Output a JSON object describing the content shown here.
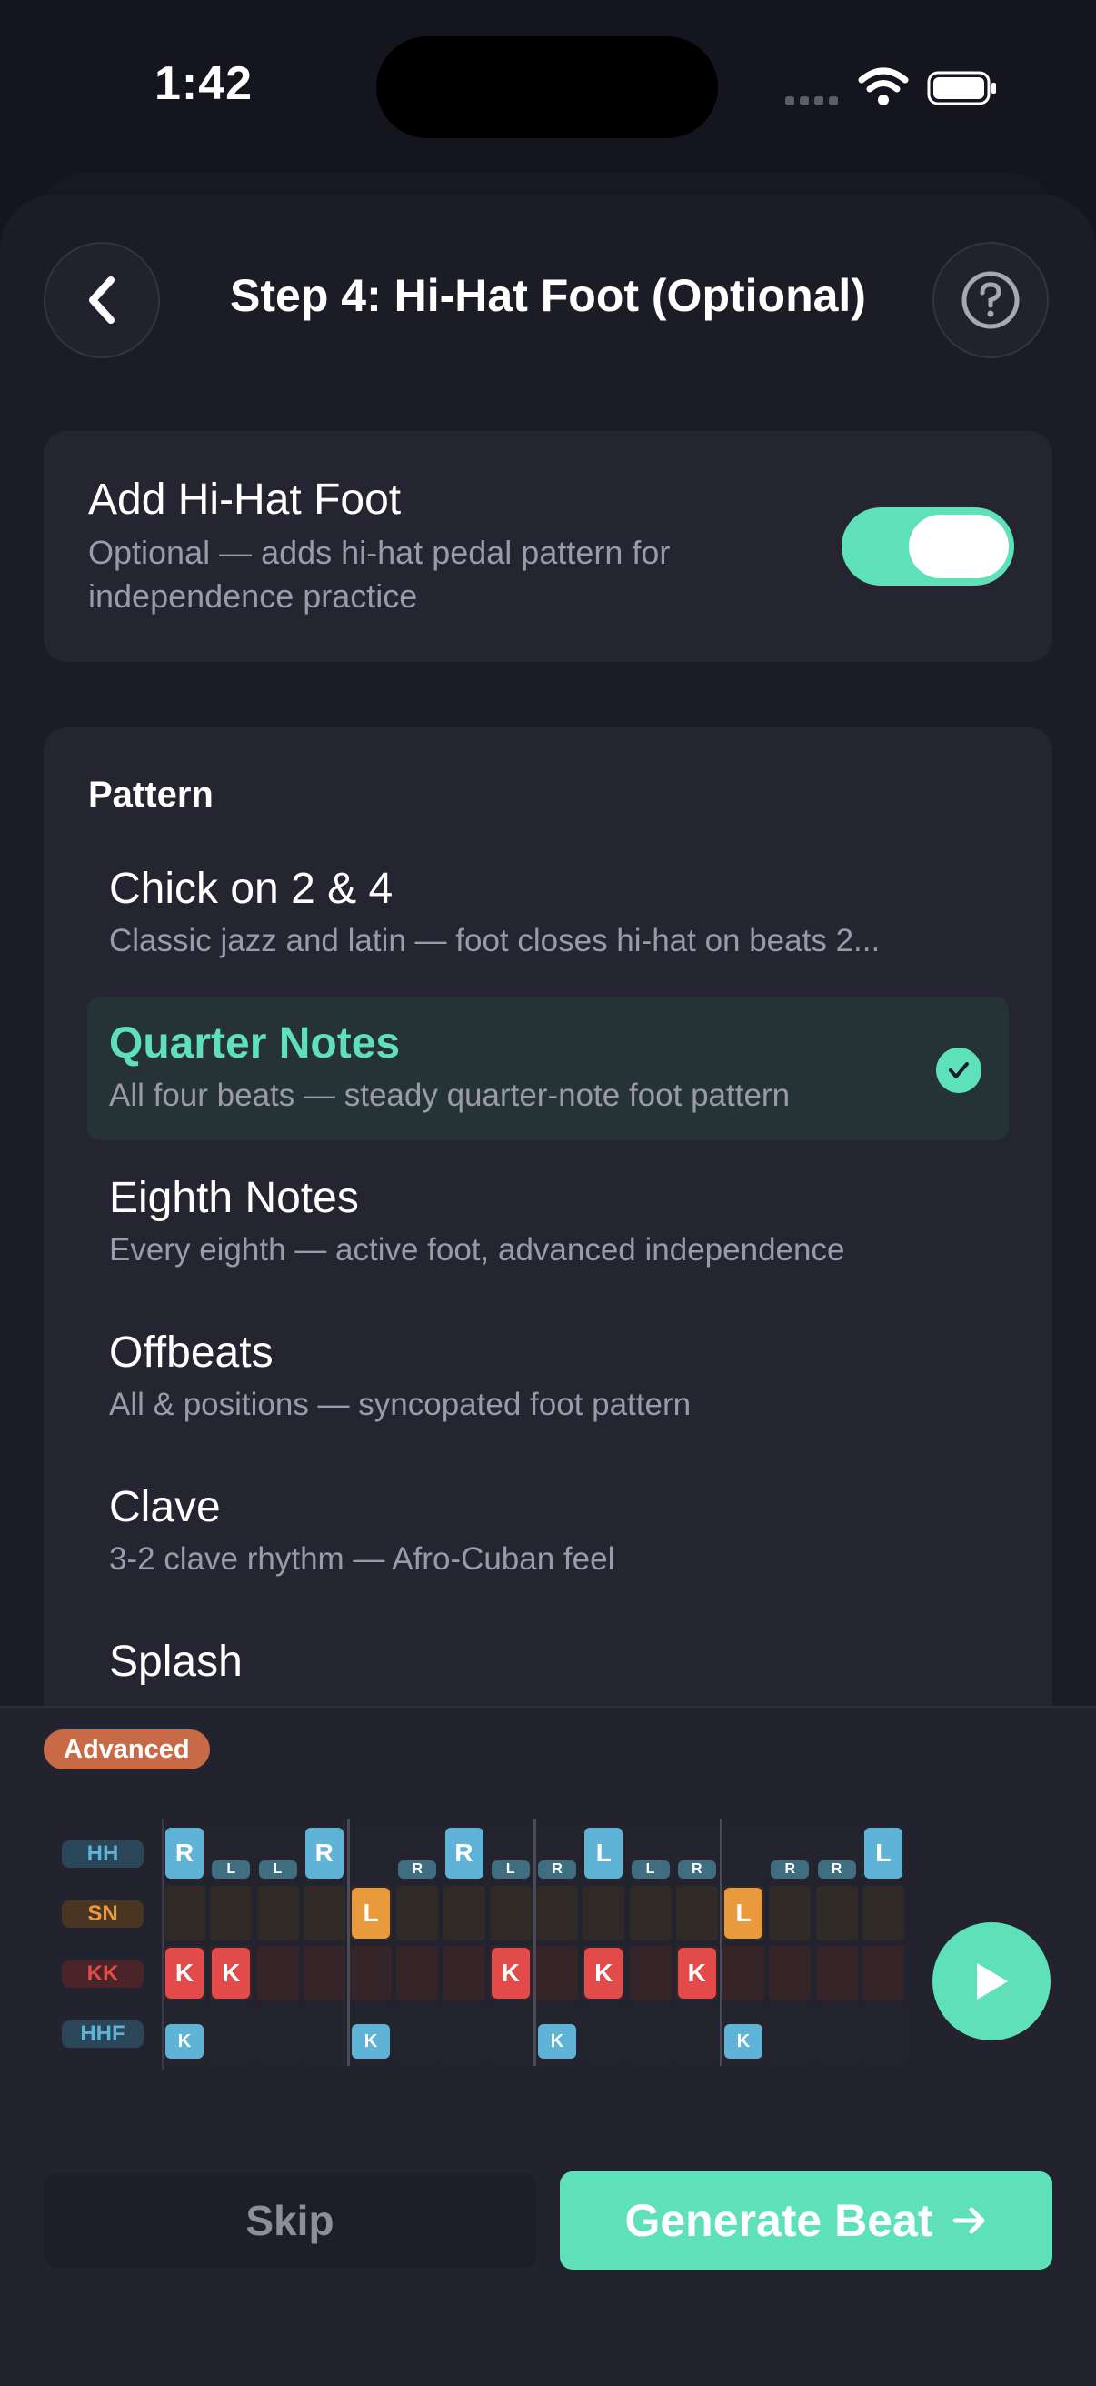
{
  "status_bar": {
    "time": "1:42"
  },
  "header": {
    "title": "Step 4: Hi-Hat Foot (Optional)",
    "back_icon": "chevron-left-icon",
    "help_icon": "question-circle-icon"
  },
  "toggle_card": {
    "title": "Add Hi-Hat Foot",
    "subtitle": "Optional — adds hi-hat pedal pattern for independence practice",
    "enabled": true
  },
  "pattern": {
    "heading": "Pattern",
    "selected": "Quarter Notes",
    "options": [
      {
        "title": "Chick on 2 & 4",
        "subtitle": "Classic jazz and latin — foot closes hi-hat on beats 2..."
      },
      {
        "title": "Quarter Notes",
        "subtitle": "All four beats — steady quarter-note foot pattern"
      },
      {
        "title": "Eighth Notes",
        "subtitle": "Every eighth — active foot, advanced independence"
      },
      {
        "title": "Offbeats",
        "subtitle": "All & positions — syncopated foot pattern"
      },
      {
        "title": "Clave",
        "subtitle": "3-2 clave rhythm — Afro-Cuban feel"
      },
      {
        "title": "Splash",
        "subtitle": ""
      }
    ]
  },
  "preview": {
    "badge": "Advanced",
    "rows": [
      {
        "label": "HH",
        "color": "#5fb3d6",
        "cells": [
          "R",
          "l",
          "l",
          "R",
          "",
          "r",
          "R",
          "l",
          "r",
          "L",
          "l",
          "r",
          "",
          "r",
          "r",
          "L"
        ]
      },
      {
        "label": "SN",
        "color": "#e89a3c",
        "cells": [
          "",
          "",
          "",
          "",
          "L",
          "",
          "",
          "",
          "",
          "",
          "",
          "",
          "L",
          "",
          "",
          ""
        ]
      },
      {
        "label": "KK",
        "color": "#e34b4b",
        "cells": [
          "K",
          "K",
          "",
          "",
          "",
          "",
          "",
          "K",
          "",
          "K",
          "",
          "K",
          "",
          "",
          "",
          ""
        ]
      },
      {
        "label": "HHF",
        "color": "#5fb3d6",
        "cells": [
          "K",
          "",
          "",
          "",
          "K",
          "",
          "",
          "",
          "K",
          "",
          "",
          "",
          "K",
          "",
          "",
          ""
        ]
      }
    ],
    "play_icon": "play-icon"
  },
  "footer": {
    "skip_label": "Skip",
    "generate_label": "Generate Beat",
    "generate_icon": "arrow-right-icon"
  },
  "colors": {
    "accent": "#5ee0b8",
    "badge": "#c96a47"
  }
}
